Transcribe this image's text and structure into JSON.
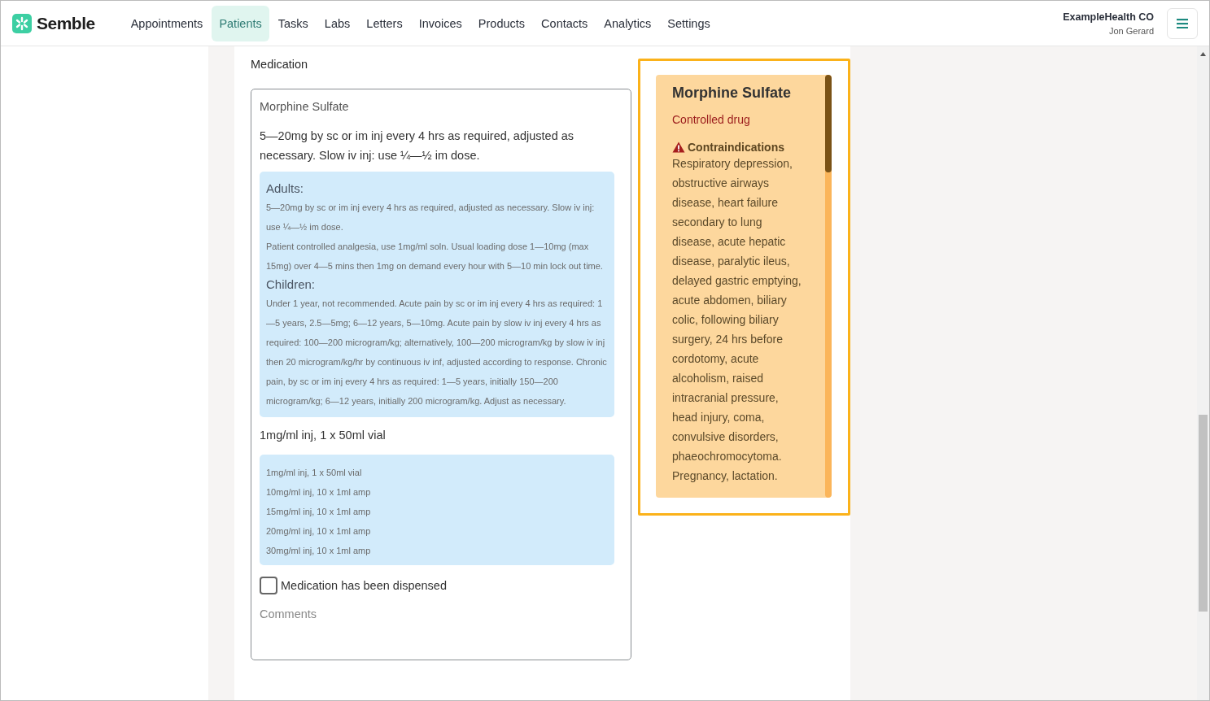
{
  "app": {
    "logo": "Semble"
  },
  "nav": [
    {
      "label": "Appointments",
      "selected": false
    },
    {
      "label": "Patients",
      "selected": true
    },
    {
      "label": "Tasks",
      "selected": false
    },
    {
      "label": "Labs",
      "selected": false
    },
    {
      "label": "Letters",
      "selected": false
    },
    {
      "label": "Invoices",
      "selected": false
    },
    {
      "label": "Products",
      "selected": false
    },
    {
      "label": "Contacts",
      "selected": false
    },
    {
      "label": "Analytics",
      "selected": false
    },
    {
      "label": "Settings",
      "selected": false
    }
  ],
  "account": {
    "organisation": "ExampleHealth CO",
    "user": "Jon Gerard"
  },
  "medication": {
    "label": "Medication",
    "drug_name": "Morphine Sulfate",
    "dosage_summary": "5—20mg by sc or im inj every 4 hrs as required, adjusted as necessary. Slow iv inj: use ¼—½ im dose.",
    "dosage_details": [
      {
        "heading": "Adults:",
        "paragraphs": [
          "5—20mg by sc or im inj every 4 hrs as required, adjusted as necessary. Slow iv inj: use ¼—½ im dose.",
          "Patient controlled analgesia, use 1mg/ml soln. Usual loading dose 1—10mg (max 15mg) over 4—5 mins then 1mg on demand every hour with 5—10 min lock out time."
        ]
      },
      {
        "heading": "Children:",
        "paragraphs": [
          "Under 1 year, not recommended. Acute pain by sc or im inj every 4 hrs as required: 1—5 years, 2.5—5mg; 6—12 years, 5—10mg. Acute pain by slow iv inj every 4 hrs as required: 100—200 microgram/kg; alternatively, 100—200 microgram/kg by slow iv inj then 20 microgram/kg/hr by continuous iv inf, adjusted according to response. Chronic pain, by sc or im inj every 4 hrs as required: 1—5 years, initially 150—200 microgram/kg; 6—12 years, initially 200 microgram/kg. Adjust as necessary."
        ]
      }
    ],
    "selected_form": "1mg/ml inj, 1 x 50ml vial",
    "forms": [
      "1mg/ml inj, 1 x 50ml vial",
      "10mg/ml inj, 10 x 1ml amp",
      "15mg/ml inj, 10 x 1ml amp",
      "20mg/ml inj, 10 x 1ml amp",
      "30mg/ml inj, 10 x 1ml amp"
    ],
    "dispensed": {
      "label": "Medication has been dispensed",
      "checked": false
    },
    "comments": {
      "placeholder": "Comments"
    }
  },
  "drug_info": {
    "title": "Morphine Sulfate",
    "category": "Controlled drug",
    "contraindications": {
      "heading": "Contraindications",
      "text": "Respiratory depression, obstructive airways disease, heart failure secondary to lung disease, acute hepatic disease, paralytic ileus, delayed gastric emptying, acute abdomen, biliary colic, following biliary surgery, 24 hrs before cordotomy, acute alcoholism, raised intracranial pressure, head injury, coma, convulsive disorders, phaeochromocytoma. Pregnancy, lactation."
    }
  }
}
